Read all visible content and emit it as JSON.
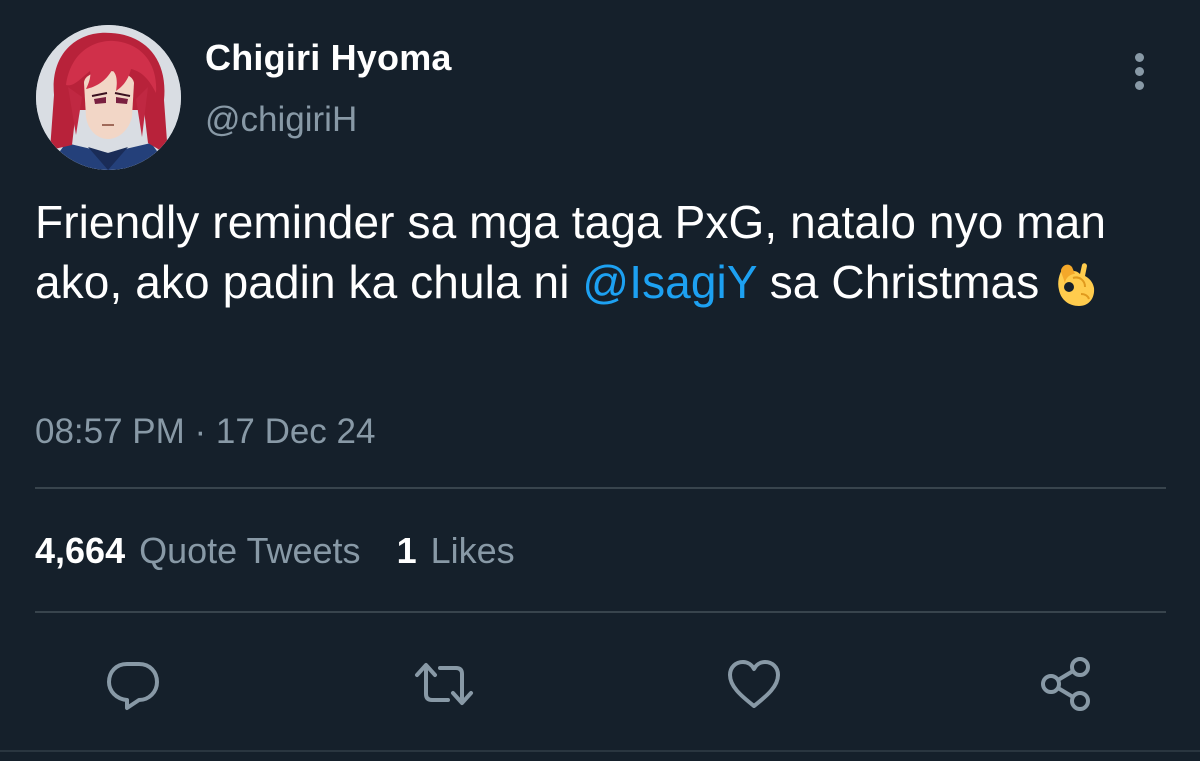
{
  "author": {
    "display_name": "Chigiri Hyoma",
    "handle": "@chigiriH",
    "avatar_icon": "anime-avatar-red-hair"
  },
  "tweet": {
    "text_part1": "Friendly reminder sa mga taga PxG, natalo nyo man ako, ako padin ka chula ni ",
    "mention": "@IsagiY",
    "text_part2": " sa Christmas",
    "emoji": "ok-hand-emoji",
    "timestamp": "08:57 PM · 17 Dec 24"
  },
  "stats": {
    "quote_tweets_count": "4,664",
    "quote_tweets_label": "Quote Tweets",
    "likes_count": "1",
    "likes_label": "Likes"
  },
  "actions": [
    {
      "icon": "reply-icon"
    },
    {
      "icon": "retweet-icon"
    },
    {
      "icon": "like-icon"
    },
    {
      "icon": "share-icon"
    }
  ],
  "colors": {
    "background": "#15202b",
    "primary_text": "#ffffff",
    "secondary_text": "#8899a6",
    "link": "#1da1f2",
    "divider": "#38444d"
  }
}
